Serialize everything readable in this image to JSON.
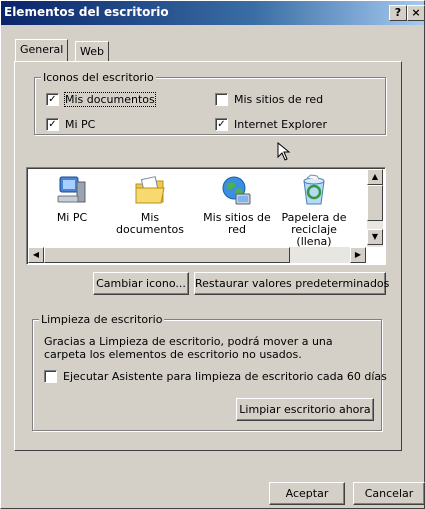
{
  "window": {
    "title": "Elementos del escritorio",
    "help_label": "?",
    "close_label": "×"
  },
  "tabs": [
    {
      "label": "General",
      "selected": true
    },
    {
      "label": "Web",
      "selected": false
    }
  ],
  "icons_group": {
    "legend": "Iconos del escritorio",
    "checkboxes": [
      {
        "label": "Mis documentos",
        "checked": true
      },
      {
        "label": "Mis sitios de red",
        "checked": false
      },
      {
        "label": "Mi PC",
        "checked": true
      },
      {
        "label": "Internet Explorer",
        "checked": true
      }
    ]
  },
  "icon_list": {
    "items": [
      {
        "line1": "Mi PC",
        "line2": "",
        "icon": "computer-icon"
      },
      {
        "line1": "Mis",
        "line2": "documentos",
        "icon": "folder-documents-icon"
      },
      {
        "line1": "Mis sitios de",
        "line2": "red",
        "icon": "network-places-icon"
      },
      {
        "line1": "Papelera de",
        "line2": "reciclaje (llena)",
        "icon": "recycle-bin-icon"
      }
    ]
  },
  "buttons": {
    "change_icon": "Cambiar icono...",
    "restore_defaults": "Restaurar valores predeterminados",
    "clean_now": "Limpiar escritorio ahora",
    "ok": "Aceptar",
    "cancel": "Cancelar"
  },
  "cleanup_group": {
    "legend": "Limpieza de escritorio",
    "description": "Gracias a Limpieza de escritorio, podrá mover a una carpeta los elementos de escritorio no usados.",
    "checkbox_label": "Ejecutar Asistente para limpieza de escritorio cada 60 días",
    "checkbox_checked": false
  }
}
